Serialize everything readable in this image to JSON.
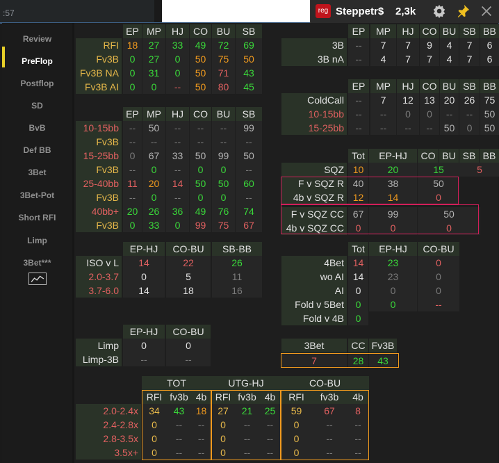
{
  "clock_fragment": ":57",
  "titlebar": {
    "badge": "reg",
    "player": "Steppetr$",
    "hands": "2,3k"
  },
  "nav": [
    "Review",
    "PreFlop",
    "Postflop",
    "SD",
    "BvB",
    "Def BB",
    "3Bet",
    "3Bet-Pot",
    "Short RFI",
    "Limp",
    "3Bet***"
  ],
  "active_nav": "PreFlop",
  "icons": {
    "settings": "gear-icon",
    "pin": "pin-icon",
    "close": "close-icon",
    "graph": "line-chart-icon"
  },
  "tables": {
    "rfi": {
      "headers": [
        "EP",
        "MP",
        "HJ",
        "CO",
        "BU",
        "SB"
      ],
      "rows": [
        {
          "label": "RFI",
          "vals": [
            "18",
            "27",
            "33",
            "49",
            "72",
            "69"
          ]
        },
        {
          "label": "Fv3B",
          "vals": [
            "0",
            "27",
            "0",
            "50",
            "75",
            "50"
          ]
        },
        {
          "label": "Fv3B NA",
          "vals": [
            "0",
            "31",
            "0",
            "50",
            "71",
            "43"
          ]
        },
        {
          "label": "Fv3B AI",
          "vals": [
            "0",
            "0",
            "--",
            "50",
            "80",
            "45"
          ]
        }
      ]
    },
    "threebet": {
      "headers": [
        "EP",
        "MP",
        "HJ",
        "CO",
        "BU",
        "SB",
        "BB"
      ],
      "rows": [
        {
          "label": "3B",
          "vals": [
            "--",
            "7",
            "7",
            "9",
            "4",
            "7",
            "6"
          ]
        },
        {
          "label": "3B nA",
          "vals": [
            "--",
            "4",
            "7",
            "7",
            "4",
            "7",
            "6"
          ]
        }
      ]
    },
    "coldcall": {
      "headers": [
        "EP",
        "MP",
        "HJ",
        "CO",
        "BU",
        "SB",
        "BB"
      ],
      "rows": [
        {
          "label": "ColdCall",
          "vals": [
            "--",
            "7",
            "12",
            "13",
            "20",
            "26",
            "75"
          ]
        },
        {
          "label": "10-15bb",
          "vals": [
            "--",
            "--",
            "0",
            "0",
            "--",
            "--",
            "50"
          ]
        },
        {
          "label": "15-25bb",
          "vals": [
            "--",
            "--",
            "--",
            "--",
            "50",
            "0",
            "50"
          ]
        }
      ]
    },
    "stack": {
      "headers": [
        "EP",
        "MP",
        "HJ",
        "CO",
        "BU",
        "SB"
      ],
      "rows": [
        {
          "label": "10-15bb",
          "vals": [
            "--",
            "50",
            "--",
            "--",
            "--",
            "99"
          ]
        },
        {
          "label": "Fv3B",
          "vals": [
            "--",
            "--",
            "--",
            "--",
            "--",
            "--"
          ]
        },
        {
          "label": "15-25bb",
          "vals": [
            "0",
            "67",
            "33",
            "50",
            "99",
            "50"
          ]
        },
        {
          "label": "Fv3B",
          "vals": [
            "--",
            "0",
            "--",
            "0",
            "0",
            "--"
          ]
        },
        {
          "label": "25-40bb",
          "vals": [
            "11",
            "20",
            "14",
            "50",
            "50",
            "60"
          ]
        },
        {
          "label": "Fv3B",
          "vals": [
            "--",
            "0",
            "--",
            "0",
            "0",
            "--"
          ]
        },
        {
          "label": "40bb+",
          "vals": [
            "20",
            "26",
            "36",
            "49",
            "76",
            "74"
          ]
        },
        {
          "label": "Fv3B",
          "vals": [
            "0",
            "33",
            "0",
            "99",
            "75",
            "67"
          ]
        }
      ]
    },
    "sqz": {
      "headers": [
        "Tot",
        "EP-HJ",
        "CO",
        "BU",
        "SB",
        "BB"
      ],
      "rows": [
        {
          "label": "SQZ",
          "vals": [
            "10",
            "20",
            "15",
            "5"
          ]
        },
        {
          "label": "F v SQZ R",
          "vals": [
            "40",
            "38",
            "50"
          ]
        },
        {
          "label": "4b v SQZ R",
          "vals": [
            "12",
            "14",
            "0"
          ]
        },
        {
          "label": "F v SQZ CC",
          "vals": [
            "67",
            "99",
            "50"
          ]
        },
        {
          "label": "4b v SQZ CC",
          "vals": [
            "0",
            "0",
            "0"
          ]
        }
      ]
    },
    "iso": {
      "headers": [
        "EP-HJ",
        "CO-BU",
        "SB-BB"
      ],
      "rows": [
        {
          "label": "ISO v L",
          "vals": [
            "14",
            "22",
            "26"
          ]
        },
        {
          "label": "2.0-3.7",
          "vals": [
            "0",
            "5",
            "11"
          ]
        },
        {
          "label": "3.7-6.0",
          "vals": [
            "14",
            "18",
            "16"
          ]
        }
      ]
    },
    "fourbet": {
      "headers": [
        "Tot",
        "EP-HJ",
        "CO-BU"
      ],
      "rows": [
        {
          "label": "4Bet",
          "vals": [
            "14",
            "23",
            "0"
          ]
        },
        {
          "label": "wo AI",
          "vals": [
            "14",
            "23",
            "0"
          ]
        },
        {
          "label": "AI",
          "vals": [
            "0",
            "0",
            "0"
          ]
        },
        {
          "label": "Fold v 5Bet",
          "vals": [
            "0",
            "0",
            "--"
          ]
        },
        {
          "label": "Fold v 4B",
          "vals": [
            "0"
          ]
        }
      ]
    },
    "limp": {
      "headers": [
        "EP-HJ",
        "CO-BU"
      ],
      "rows": [
        {
          "label": "Limp",
          "vals": [
            "0",
            "0"
          ]
        },
        {
          "label": "Limp-3B",
          "vals": [
            "--",
            "--"
          ]
        }
      ]
    },
    "threebet_cc": {
      "headers": [
        "3Bet",
        "CC",
        "Fv3B"
      ],
      "vals": [
        "7",
        "28",
        "43"
      ]
    },
    "sizing": {
      "groups": [
        "TOT",
        "UTG-HJ",
        "CO-BU"
      ],
      "subheaders": [
        "RFI",
        "fv3b",
        "4b",
        "RFI",
        "fv3b",
        "4b",
        "RFI",
        "fv3b",
        "4b"
      ],
      "rows": [
        {
          "label": "2.0-2.4x",
          "vals": [
            "34",
            "43",
            "18",
            "27",
            "21",
            "25",
            "59",
            "67",
            "8"
          ]
        },
        {
          "label": "2.4-2.8x",
          "vals": [
            "0",
            "--",
            "--",
            "0",
            "--",
            "--",
            "0",
            "--",
            "--"
          ]
        },
        {
          "label": "2.8-3.5x",
          "vals": [
            "0",
            "--",
            "--",
            "0",
            "--",
            "--",
            "0",
            "--",
            "--"
          ]
        },
        {
          "label": "3.5x+",
          "vals": [
            "0",
            "--",
            "--",
            "0",
            "--",
            "--",
            "0",
            "--",
            "--"
          ]
        }
      ]
    }
  }
}
